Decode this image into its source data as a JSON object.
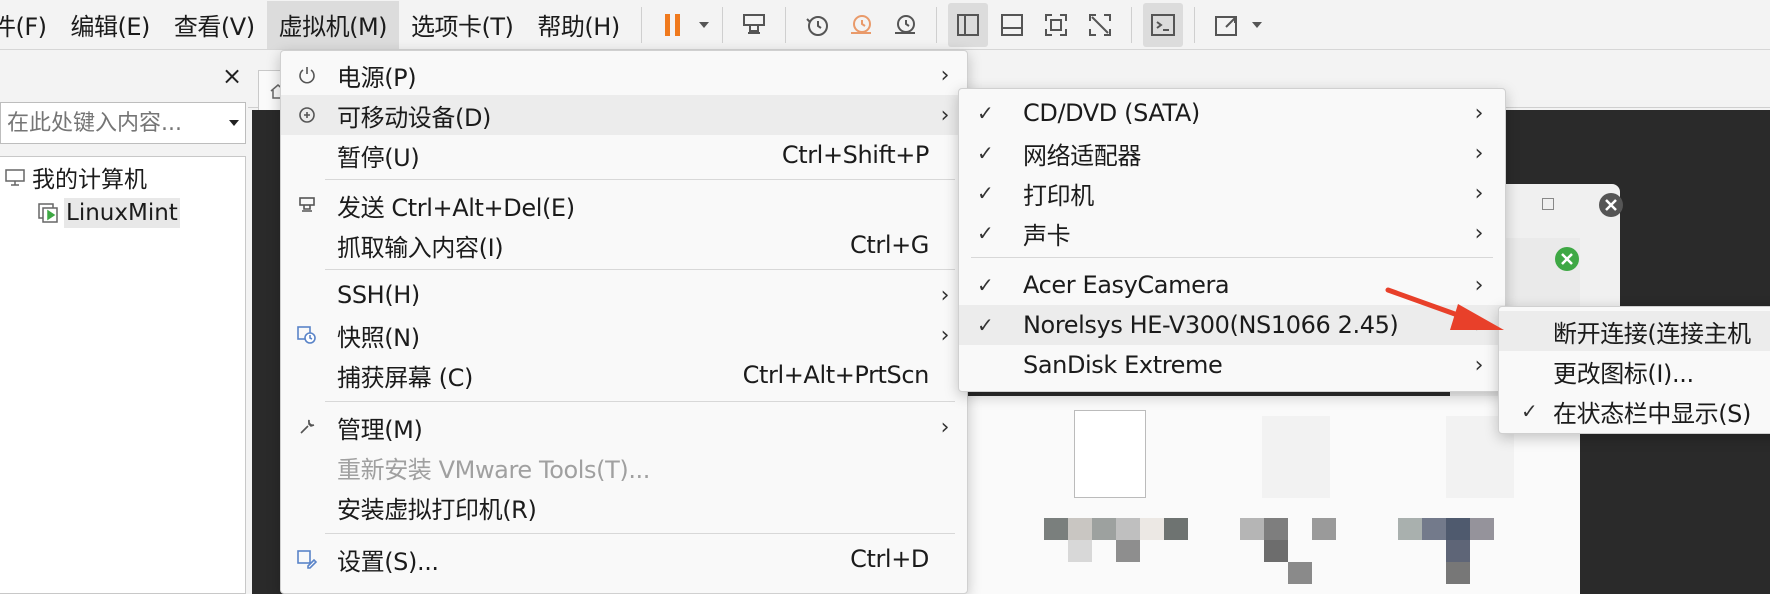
{
  "menubar": {
    "items": [
      {
        "label": "件(F)"
      },
      {
        "label": "编辑(E)"
      },
      {
        "label": "查看(V)"
      },
      {
        "label": "虚拟机(M)"
      },
      {
        "label": "选项卡(T)"
      },
      {
        "label": "帮助(H)"
      }
    ],
    "toolbar_icons": [
      "pause-icon",
      "send-ctrl-alt-del-icon",
      "snapshot-icon",
      "revert-snapshot-icon",
      "snapshot-manager-icon",
      "show-library-icon",
      "thumbnail-bar-icon",
      "fullscreen-icon",
      "unity-icon",
      "console-icon",
      "stretch-icon"
    ]
  },
  "library": {
    "close": "×",
    "search_placeholder": "在此处键入内容...",
    "tree": [
      {
        "label": "我的计算机"
      },
      {
        "label": "LinuxMint"
      }
    ]
  },
  "vm_menu": {
    "items": [
      {
        "label": "电源(P)",
        "shortcut": "",
        "submenu": true
      },
      {
        "label": "可移动设备(D)",
        "shortcut": "",
        "submenu": true,
        "highlighted": true
      },
      {
        "label": "暂停(U)",
        "shortcut": "Ctrl+Shift+P"
      },
      {
        "label": "发送 Ctrl+Alt+Del(E)",
        "shortcut": ""
      },
      {
        "label": "抓取输入内容(I)",
        "shortcut": "Ctrl+G"
      },
      {
        "label": "SSH(H)",
        "shortcut": "",
        "submenu": true
      },
      {
        "label": "快照(N)",
        "shortcut": "",
        "submenu": true
      },
      {
        "label": "捕获屏幕 (C)",
        "shortcut": "Ctrl+Alt+PrtScn"
      },
      {
        "label": "管理(M)",
        "shortcut": "",
        "submenu": true
      },
      {
        "label": "重新安装 VMware Tools(T)...",
        "shortcut": "",
        "disabled": true
      },
      {
        "label": "安装虚拟打印机(R)",
        "shortcut": ""
      },
      {
        "label": "设置(S)...",
        "shortcut": "Ctrl+D"
      }
    ]
  },
  "devices_menu": {
    "items": [
      {
        "label": "CD/DVD (SATA)",
        "checked": true
      },
      {
        "label": "网络适配器",
        "checked": true
      },
      {
        "label": "打印机",
        "checked": true
      },
      {
        "label": "声卡",
        "checked": true
      },
      {
        "label": "Acer EasyCamera",
        "checked": true
      },
      {
        "label": "Norelsys HE-V300(NS1066 2.45)",
        "checked": true,
        "highlighted": true
      },
      {
        "label": "SanDisk Extreme",
        "checked": false
      }
    ]
  },
  "usb_submenu": {
    "items": [
      {
        "label": "断开连接(连接主机",
        "checked": false,
        "highlighted": true
      },
      {
        "label": "更改图标(I)...",
        "checked": false
      },
      {
        "label": "在状态栏中显示(S)",
        "checked": true
      }
    ]
  },
  "symbols": {
    "arrow": "›",
    "check": "✓"
  },
  "colors": {
    "pause": "#f07a1e",
    "annotation_arrow": "#e8402a",
    "close_circle": "#555555",
    "ok_circle": "#3ea844"
  }
}
